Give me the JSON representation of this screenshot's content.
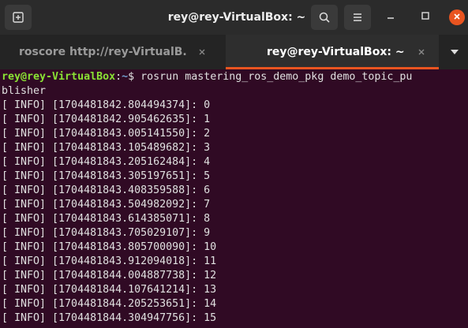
{
  "window": {
    "title": "rey@rey-VirtualBox: ~"
  },
  "header": {
    "new_tab_icon": "new-tab-icon",
    "search_icon": "search-icon",
    "menu_icon": "hamburger-menu-icon",
    "minimize_icon": "minimize-icon",
    "maximize_icon": "maximize-icon",
    "close_icon": "close-icon"
  },
  "tabs": [
    {
      "label": "roscore http://rey-VirtualB...",
      "active": false
    },
    {
      "label": "rey@rey-VirtualBox: ~",
      "active": true
    }
  ],
  "terminal": {
    "prompt_user": "rey@rey-VirtualBox",
    "prompt_sep": ":",
    "prompt_path": "~",
    "prompt_symbol": "$",
    "command_line1": " rosrun mastering_ros_demo_pkg demo_topic_pu",
    "command_line2": "blisher",
    "output": [
      "[ INFO] [1704481842.804494374]: 0",
      "[ INFO] [1704481842.905462635]: 1",
      "[ INFO] [1704481843.005141550]: 2",
      "[ INFO] [1704481843.105489682]: 3",
      "[ INFO] [1704481843.205162484]: 4",
      "[ INFO] [1704481843.305197651]: 5",
      "[ INFO] [1704481843.408359588]: 6",
      "[ INFO] [1704481843.504982092]: 7",
      "[ INFO] [1704481843.614385071]: 8",
      "[ INFO] [1704481843.705029107]: 9",
      "[ INFO] [1704481843.805700090]: 10",
      "[ INFO] [1704481843.912094018]: 11",
      "[ INFO] [1704481844.004887738]: 12",
      "[ INFO] [1704481844.107641214]: 13",
      "[ INFO] [1704481844.205253651]: 14",
      "[ INFO] [1704481844.304947756]: 15"
    ]
  },
  "colors": {
    "terminal_bg": "#300a24",
    "accent": "#e95420",
    "prompt_user": "#8ae234",
    "prompt_path": "#729fcf"
  }
}
